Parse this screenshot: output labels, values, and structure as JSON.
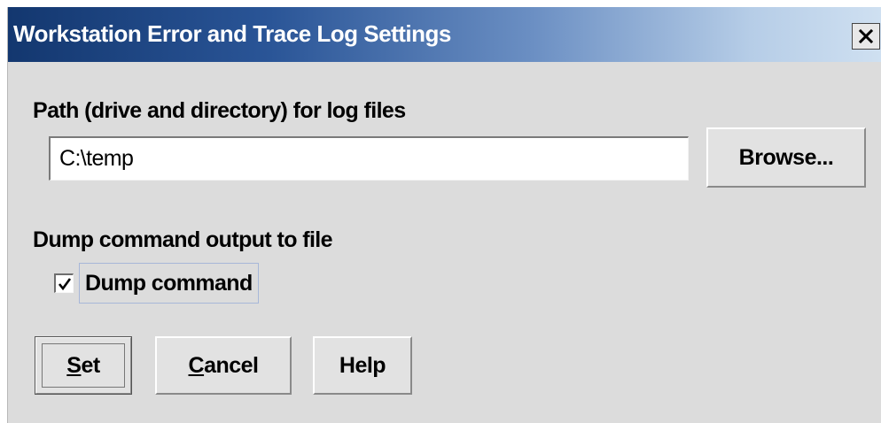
{
  "window": {
    "title": "Workstation Error and Trace Log Settings",
    "close_icon": "close-icon"
  },
  "log_path": {
    "label": "Path (drive and directory) for log files",
    "value": "C:\\temp",
    "browse_label": "Browse..."
  },
  "dump": {
    "section_label": "Dump command output to file",
    "checkbox_label": "Dump command",
    "checked": true
  },
  "buttons": {
    "set": {
      "mnemonic": "S",
      "rest": "et"
    },
    "cancel": {
      "mnemonic": "C",
      "rest": "ancel"
    },
    "help": "Help"
  },
  "colors": {
    "title_gradient_start": "#13376f",
    "title_gradient_end": "#cfe0f1",
    "dialog_background": "#dcdcdc"
  }
}
